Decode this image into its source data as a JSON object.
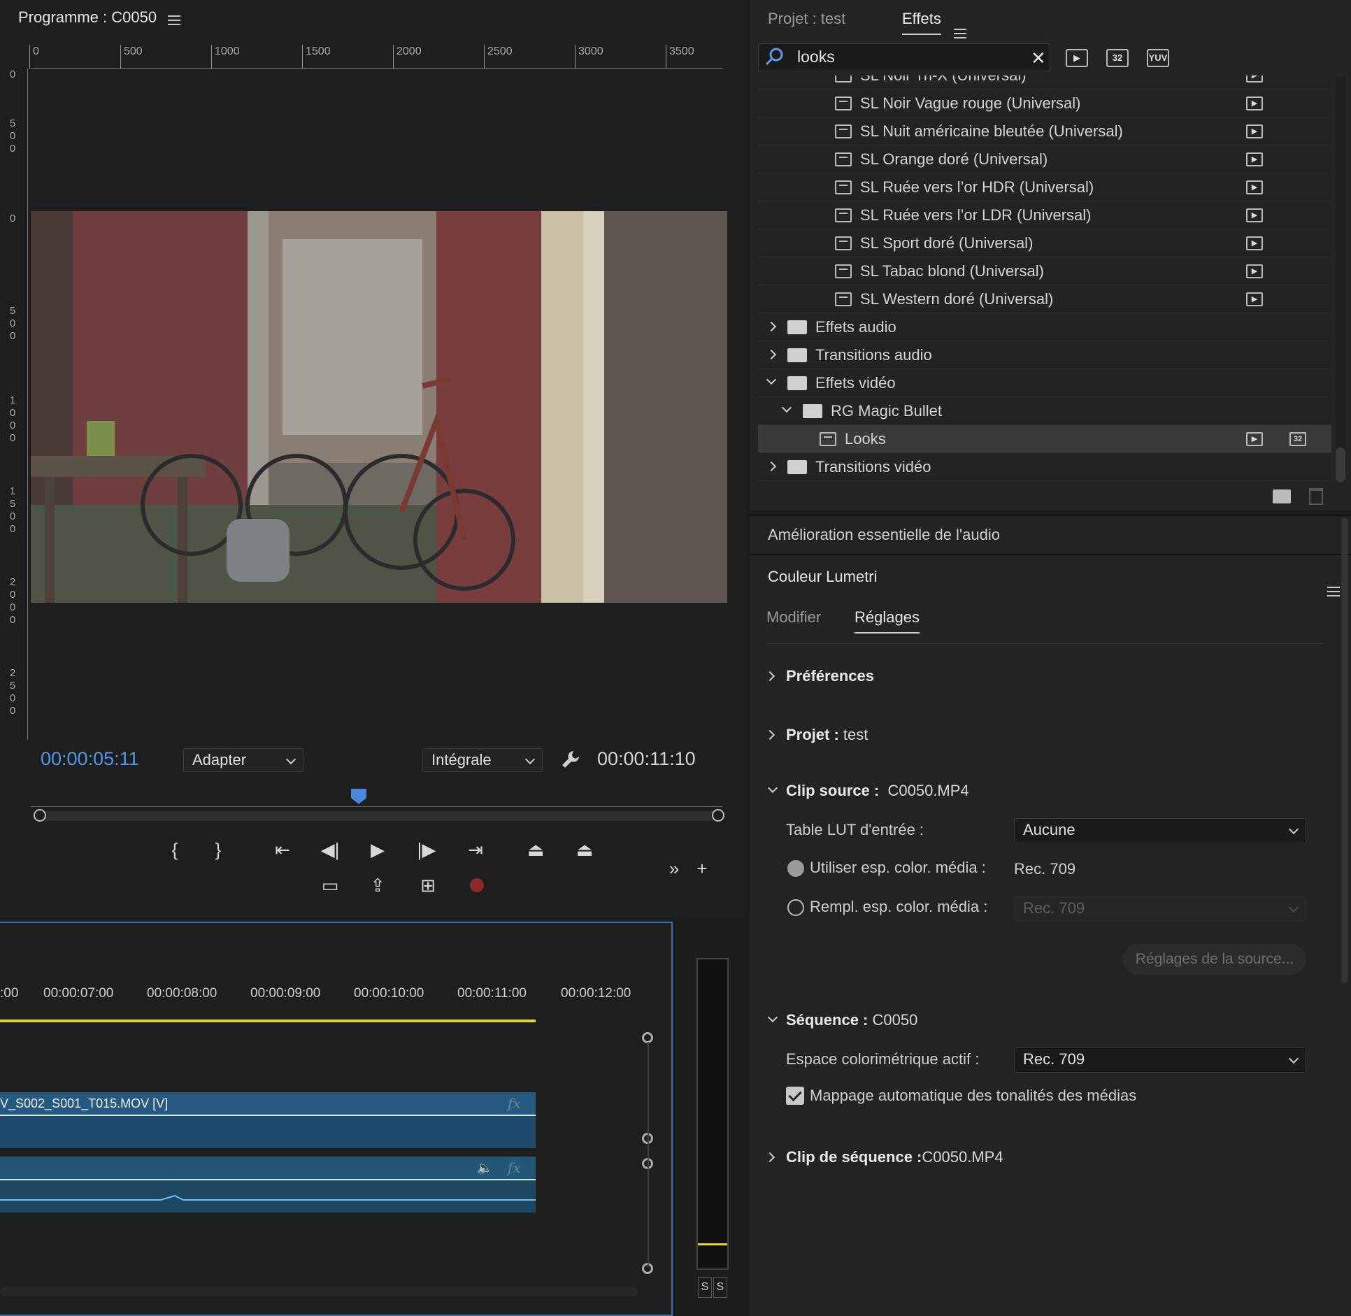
{
  "monitor": {
    "title": "Programme : C0050",
    "ruler_top": [
      "0",
      "500",
      "1000",
      "1500",
      "2000",
      "2500",
      "3000",
      "3500"
    ],
    "ruler_left": [
      "0",
      "5\n0\n0",
      "0",
      "5\n0\n0",
      "1\n0\n0\n0",
      "1\n5\n0\n0",
      "2\n0\n0\n0",
      "2\n5\n0\n0"
    ],
    "current_time": "00:00:05:11",
    "zoom": "Adapter",
    "resolution": "Intégrale",
    "duration": "00:00:11:10",
    "transport_buttons": [
      "mark-in",
      "mark-out",
      "go-to-in",
      "step-back",
      "play",
      "step-forward",
      "go-to-out",
      "lift",
      "extract",
      "safe-margins",
      "export-frame",
      "multicam",
      "record"
    ]
  },
  "timeline": {
    "times": [
      ":00",
      "00:00:07:00",
      "00:00:08:00",
      "00:00:09:00",
      "00:00:10:00",
      "00:00:11:00",
      "00:00:12:00"
    ],
    "video_clip": "V_S002_S001_T015.MOV [V]",
    "fx": "fx",
    "vu_labels": [
      "S",
      "S"
    ]
  },
  "effects": {
    "tab_project": "Projet : test",
    "tab_effects": "Effets",
    "search_value": "looks",
    "filter_labels": [
      "32",
      "YUV"
    ],
    "items": [
      {
        "label": "SL Noir Tri-X (Universal)",
        "type": "preset",
        "level": 4
      },
      {
        "label": "SL Noir Vague rouge (Universal)",
        "type": "preset",
        "level": 4
      },
      {
        "label": "SL Nuit américaine bleutée (Universal)",
        "type": "preset",
        "level": 4
      },
      {
        "label": "SL Orange doré (Universal)",
        "type": "preset",
        "level": 4
      },
      {
        "label": "SL Ruée vers l’or HDR (Universal)",
        "type": "preset",
        "level": 4
      },
      {
        "label": "SL Ruée vers l’or LDR (Universal)",
        "type": "preset",
        "level": 4
      },
      {
        "label": "SL Sport doré (Universal)",
        "type": "preset",
        "level": 4
      },
      {
        "label": "SL Tabac blond (Universal)",
        "type": "preset",
        "level": 4
      },
      {
        "label": "SL Western doré (Universal)",
        "type": "preset",
        "level": 4
      },
      {
        "label": "Effets audio",
        "type": "folder",
        "level": 0,
        "open": false
      },
      {
        "label": "Transitions audio",
        "type": "folder",
        "level": 0,
        "open": false
      },
      {
        "label": "Effets vidéo",
        "type": "folder",
        "level": 0,
        "open": true
      },
      {
        "label": "RG Magic Bullet",
        "type": "folder",
        "level": 1,
        "open": true
      },
      {
        "label": "Looks",
        "type": "effect",
        "level": 2,
        "selected": true
      },
      {
        "label": "Transitions vidéo",
        "type": "folder",
        "level": 0,
        "open": false
      }
    ]
  },
  "audio_panel": {
    "title": "Amélioration essentielle de l'audio"
  },
  "lumetri": {
    "title": "Couleur Lumetri",
    "tab_modify": "Modifier",
    "tab_settings": "Réglages",
    "preferences": "Préférences",
    "project_label": "Projet :",
    "project_value": "test",
    "clip_source_label": "Clip source :",
    "clip_source_value": "C0050.MP4",
    "lut_label": "Table LUT d'entrée :",
    "lut_value": "Aucune",
    "use_media_label": "Utiliser esp. color. média :",
    "use_media_value": "Rec. 709",
    "override_label": "Rempl. esp. color. média :",
    "override_value": "Rec. 709",
    "source_settings_button": "Réglages de la source...",
    "sequence_label": "Séquence :",
    "sequence_value": "C0050",
    "colorspace_label": "Espace colorimétrique actif :",
    "colorspace_value": "Rec. 709",
    "tonemap_label": "Mappage automatique des tonalités des médias",
    "seq_clip_label": "Clip de séquence :",
    "seq_clip_value": "C0050.MP4"
  }
}
